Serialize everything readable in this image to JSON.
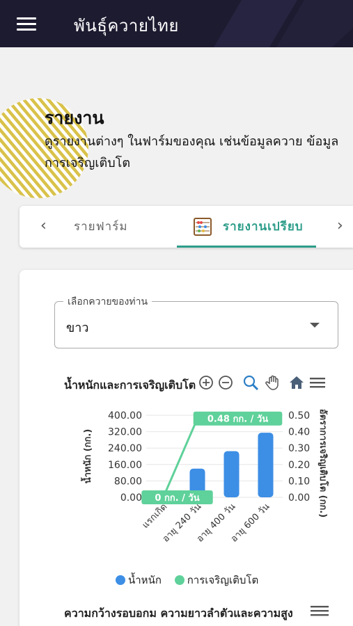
{
  "app": {
    "title": "พันธุ์ควายไทย"
  },
  "hero": {
    "title": "รายงาน",
    "description": "ดูรายงานต่างๆ ในฟาร์มของคุณ เช่นข้อมูลควาย ข้อมูลการเจริญเติบโต"
  },
  "tabs": [
    {
      "label": "รายฟาร์ม",
      "active": false
    },
    {
      "label": "รายงานเปรียบ",
      "active": true
    }
  ],
  "select": {
    "legend": "เลือกควายของท่าน",
    "value": "ขาว"
  },
  "chart": {
    "title": "น้ำหนักและการเจริญเติบโต",
    "toolbar_icons": [
      "zoom-in-icon",
      "zoom-out-icon",
      "zoom-icon",
      "pan-hand-icon",
      "home-icon",
      "menu-icon"
    ]
  },
  "chart_data": {
    "type": "bar",
    "categories": [
      "แรกเกิด",
      "อายุ 240 วัน",
      "อายุ 400 วัน",
      "อายุ 600 วัน"
    ],
    "series": [
      {
        "name": "น้ำหนัก",
        "type": "bar",
        "axis": "left",
        "color": "#3d8ee5",
        "values": [
          0,
          140,
          225,
          315
        ]
      },
      {
        "name": "การเจริญเติบโต",
        "type": "line",
        "axis": "right",
        "color": "#5fd19a",
        "values": [
          0,
          0.48,
          0.48,
          0.48
        ]
      }
    ],
    "ylabel": "น้ำหนัก (กก.)",
    "ylabel_right": "อัตราการเจริญเติบโต (กก.)",
    "ylim": [
      0,
      400
    ],
    "ylim_right": [
      0,
      0.5
    ],
    "yticks": [
      "0.00",
      "80.00",
      "160.00",
      "240.00",
      "320.00",
      "400.00"
    ],
    "yticks_right": [
      "0.00",
      "0.10",
      "0.20",
      "0.30",
      "0.40",
      "0.50"
    ],
    "annotations": [
      "0 กก. / วัน",
      "0.48 กก. / วัน"
    ],
    "grid": true,
    "legend": "bottom"
  },
  "legend": [
    "น้ำหนัก",
    "การเจริญเติบโต"
  ],
  "next_chart": {
    "title": "ความกว้างรอบอกม ความยาวลำตัวและความสูง"
  },
  "colors": {
    "appbar": "#1d1b30",
    "accent": "#2d9d8a",
    "weight": "#3d8ee5",
    "growth": "#5fd19a",
    "hero_stripe": "#d9c24a"
  }
}
